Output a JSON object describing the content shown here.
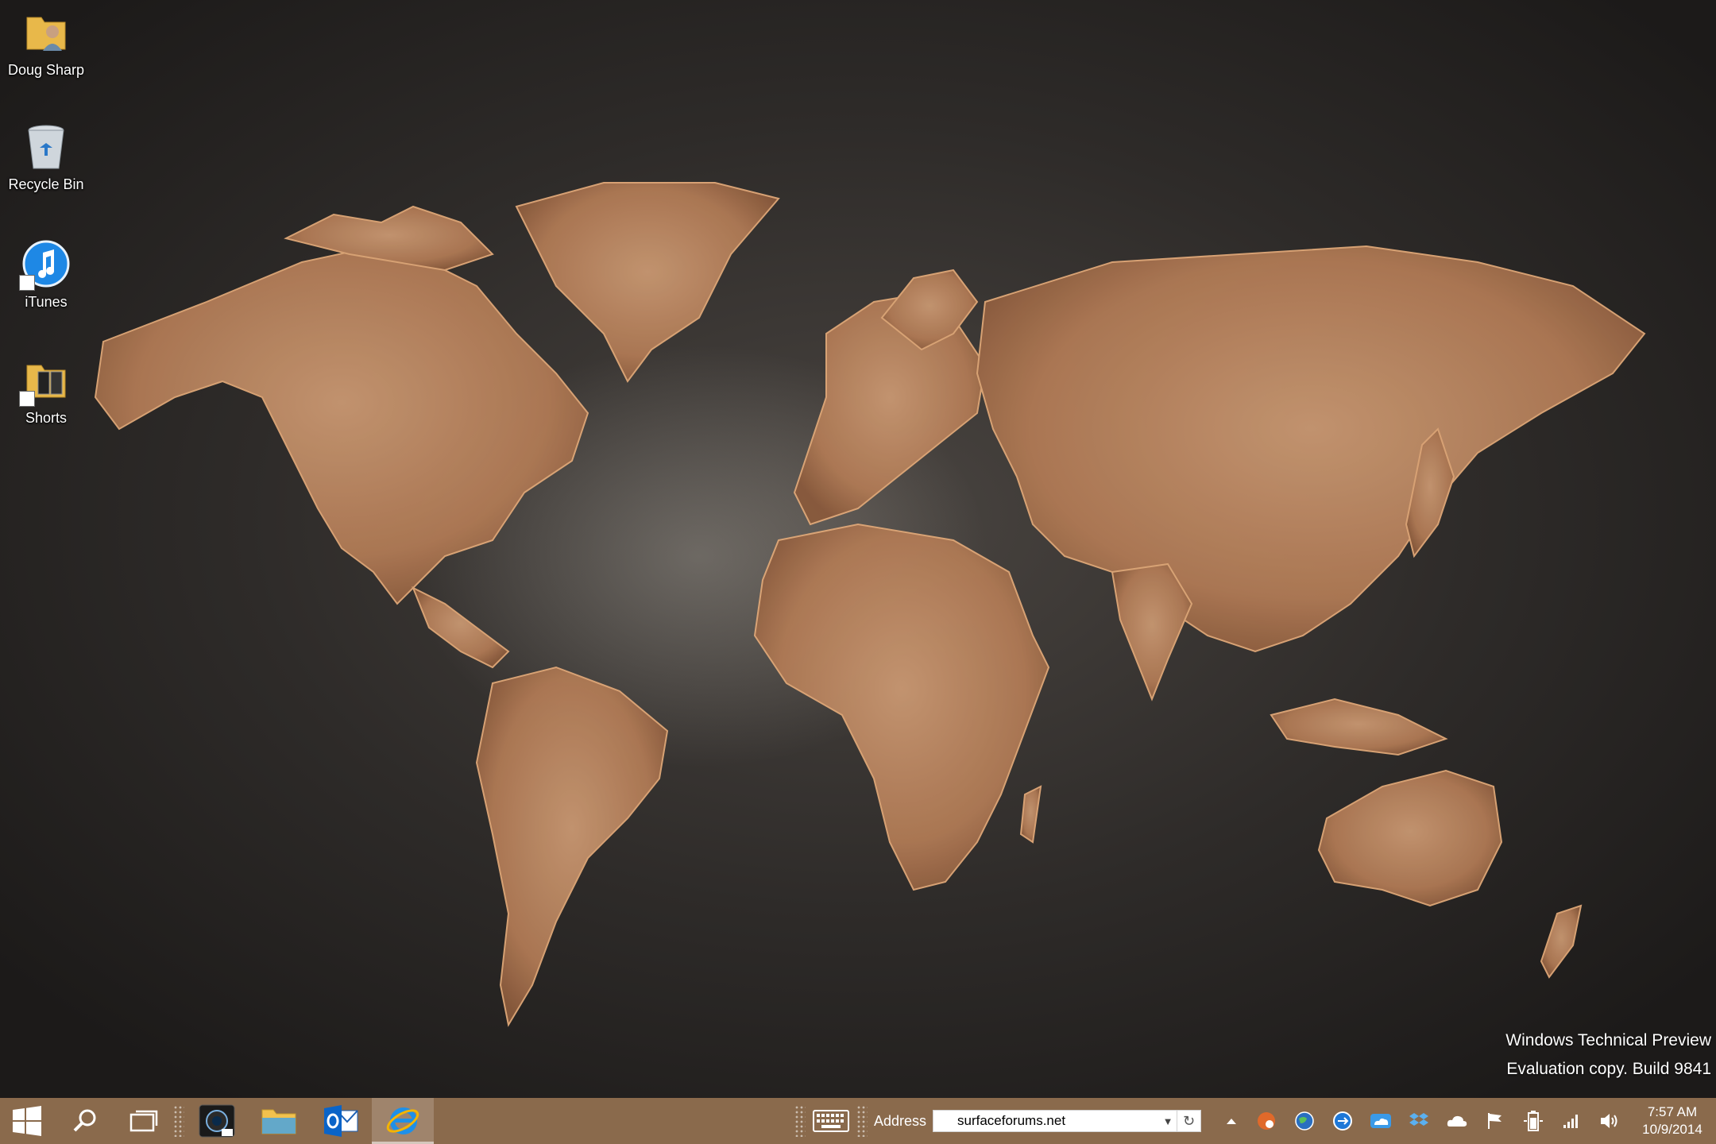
{
  "desktop": {
    "icons": [
      {
        "label": "Doug Sharp",
        "icon": "user-folder-icon"
      },
      {
        "label": "Recycle Bin",
        "icon": "recycle-bin-icon"
      },
      {
        "label": "iTunes",
        "icon": "itunes-icon"
      },
      {
        "label": "Shorts",
        "icon": "shortcuts-folder-icon"
      }
    ],
    "watermark": {
      "line1": "Windows Technical Preview",
      "line2": "Evaluation copy. Build 9841"
    }
  },
  "taskbar": {
    "color": "#8a6a4c",
    "start_icon": "windows-logo-icon",
    "search_icon": "search-icon",
    "task_view_icon": "task-view-icon",
    "pinned_apps": [
      {
        "name": "camera-app",
        "icon": "camera-icon"
      },
      {
        "name": "file-explorer",
        "icon": "folder-icon"
      },
      {
        "name": "outlook",
        "icon": "outlook-icon"
      },
      {
        "name": "internet-explorer",
        "icon": "internet-explorer-icon",
        "active": true
      }
    ],
    "touch_keyboard_icon": "keyboard-icon",
    "address_toolbar": {
      "label": "Address",
      "value": "surfaceforums.net"
    },
    "tray": {
      "show_hidden_icon": "chevron-up-icon",
      "icons": [
        "orange-app-icon",
        "globe-icon",
        "blue-circle-app-icon",
        "onedrive-icon",
        "dropbox-icon",
        "cloud-icon",
        "action-center-flag-icon",
        "battery-icon",
        "wifi-signal-icon",
        "volume-icon"
      ]
    },
    "clock": {
      "time": "7:57 AM",
      "date": "10/9/2014"
    }
  }
}
